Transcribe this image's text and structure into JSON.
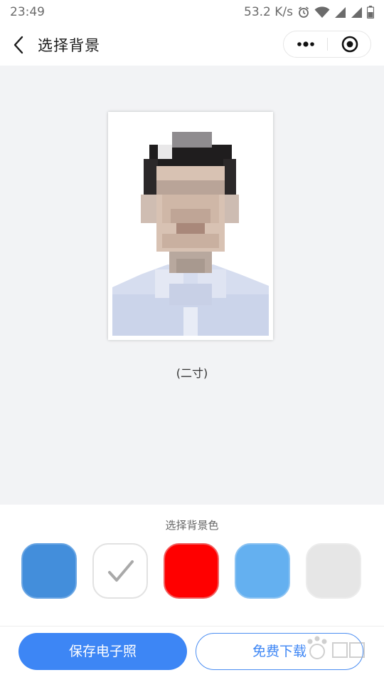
{
  "status_bar": {
    "time": "23:49",
    "network_speed": "53.2 K/s",
    "icons": [
      "alarm-icon",
      "wifi-icon",
      "signal-icon",
      "signal-icon",
      "battery-icon"
    ]
  },
  "nav": {
    "title": "选择背景",
    "back_icon": "chevron-left-icon",
    "more_icon": "more-dots-icon",
    "close_icon": "target-close-icon"
  },
  "photo": {
    "size_label": "(二寸)",
    "background_color": "#ffffff"
  },
  "color_picker": {
    "title": "选择背景色",
    "selected_index": 1,
    "swatches": [
      {
        "color": "#438edb",
        "name": "blue"
      },
      {
        "color": "#ffffff",
        "name": "white"
      },
      {
        "color": "#ff0000",
        "name": "red"
      },
      {
        "color": "#64b0f0",
        "name": "light-blue"
      },
      {
        "color": "#e6e6e6",
        "name": "gray"
      }
    ]
  },
  "actions": {
    "save_label": "保存电子照",
    "download_label": "免费下载"
  },
  "colors": {
    "accent": "#3d86f5",
    "page_background": "#f2f3f5"
  }
}
